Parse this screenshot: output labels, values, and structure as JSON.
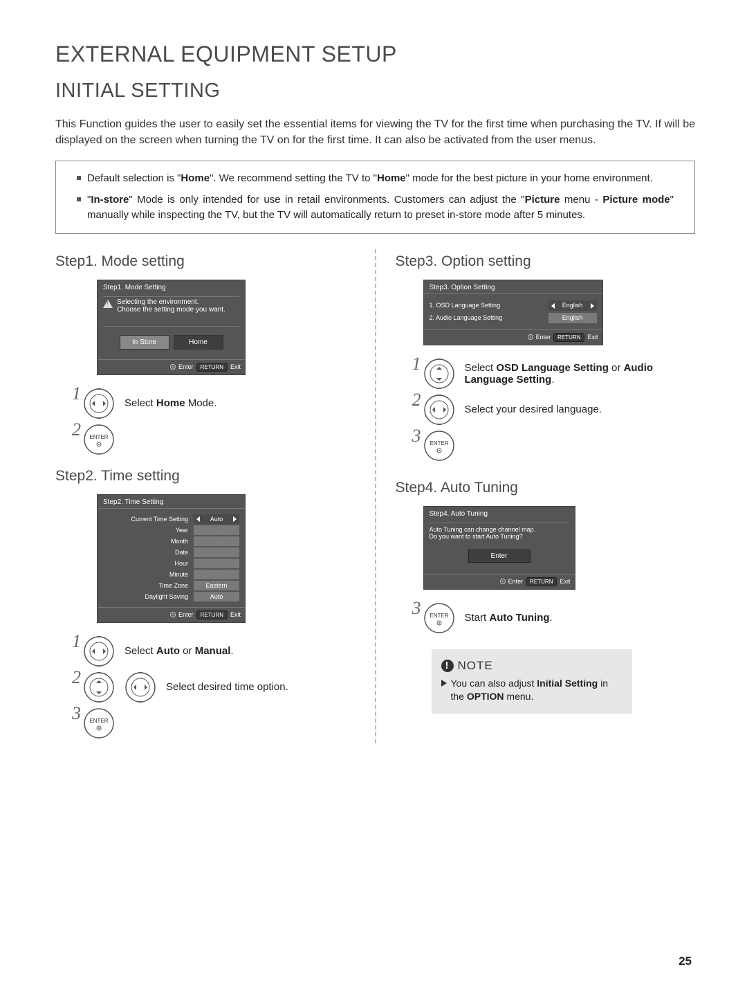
{
  "page": {
    "title": "EXTERNAL EQUIPMENT SETUP",
    "subtitle": "INITIAL SETTING",
    "intro": "This Function guides the user to easily set the essential items for viewing the TV for the first time when purchasing the TV. If will be displayed on the screen when turning the TV on for the first time. It can also be activated from the user menus.",
    "number": "25"
  },
  "info": {
    "item1_a": "Default selection is \"",
    "item1_b": "Home",
    "item1_c": "\". We recommend setting the TV to \"",
    "item1_d": "Home",
    "item1_e": "\" mode for the best picture in your home environment.",
    "item2_a": "\"",
    "item2_b": "In-store",
    "item2_c": "\" Mode is only intended for use in retail environments. Customers can adjust the \"",
    "item2_d": "Picture",
    "item2_e": " menu - ",
    "item2_f": "Picture mode",
    "item2_g": "\" manually while inspecting the TV, but the TV will automatically return to preset in-store mode after 5 minutes."
  },
  "step1": {
    "heading": "Step1. Mode setting",
    "panel": {
      "title": "Step1. Mode Setting",
      "msg1": "Selecting the environment.",
      "msg2": "Choose the setting mode you want.",
      "btn_instore": "In Store",
      "btn_home": "Home",
      "enter": "Enter",
      "return": "RETURN",
      "exit": "Exit"
    },
    "inst1_a": "Select ",
    "inst1_b": "Home",
    "inst1_c": " Mode."
  },
  "step2": {
    "heading": "Step2. Time setting",
    "panel": {
      "title": "Step2. Time Setting",
      "rows": [
        {
          "label": "Current Time Setting",
          "value": "Auto",
          "arrows": true,
          "dark": true
        },
        {
          "label": "Year",
          "value": "----",
          "arrows": false,
          "dark": false
        },
        {
          "label": "Month",
          "value": "--",
          "arrows": false,
          "dark": false
        },
        {
          "label": "Date",
          "value": "--",
          "arrows": false,
          "dark": false
        },
        {
          "label": "Hour",
          "value": "--",
          "arrows": false,
          "dark": false
        },
        {
          "label": "Minute",
          "value": "--",
          "arrows": false,
          "dark": false
        },
        {
          "label": "Time Zone",
          "value": "Eastern",
          "arrows": false,
          "dark": false
        },
        {
          "label": "Daylight Saving",
          "value": "Auto",
          "arrows": false,
          "dark": false
        }
      ],
      "enter": "Enter",
      "return": "RETURN",
      "exit": "Exit"
    },
    "inst1_a": "Select ",
    "inst1_b": "Auto",
    "inst1_c": " or ",
    "inst1_d": "Manual",
    "inst1_e": ".",
    "inst2": "Select desired time option."
  },
  "step3": {
    "heading": "Step3. Option setting",
    "panel": {
      "title": "Step3. Option Setting",
      "row1_label": "1. OSD Language Setting",
      "row1_value": "English",
      "row2_label": "2. Audio Language Setting",
      "row2_value": "English",
      "enter": "Enter",
      "return": "RETURN",
      "exit": "Exit"
    },
    "inst1_a": "Select ",
    "inst1_b": "OSD Language Setting",
    "inst1_c": " or ",
    "inst1_d": "Audio Language Setting",
    "inst1_e": ".",
    "inst2": "Select your desired language."
  },
  "step4": {
    "heading": "Step4. Auto Tuning",
    "panel": {
      "title": "Step4. Auto Tuning",
      "msg1": "Auto Tuning can change channel map.",
      "msg2": "Do you want to start Auto Tuning?",
      "enter_btn": "Enter",
      "enter": "Enter",
      "return": "RETURN",
      "exit": "Exit"
    },
    "inst3_a": "Start ",
    "inst3_b": "Auto Tuning",
    "inst3_c": "."
  },
  "note": {
    "head": "NOTE",
    "body_a": "You can also adjust ",
    "body_b": "Initial Setting",
    "body_c": " in the ",
    "body_d": "OPTION",
    "body_e": " menu."
  },
  "icons": {
    "enter_label": "ENTER"
  }
}
